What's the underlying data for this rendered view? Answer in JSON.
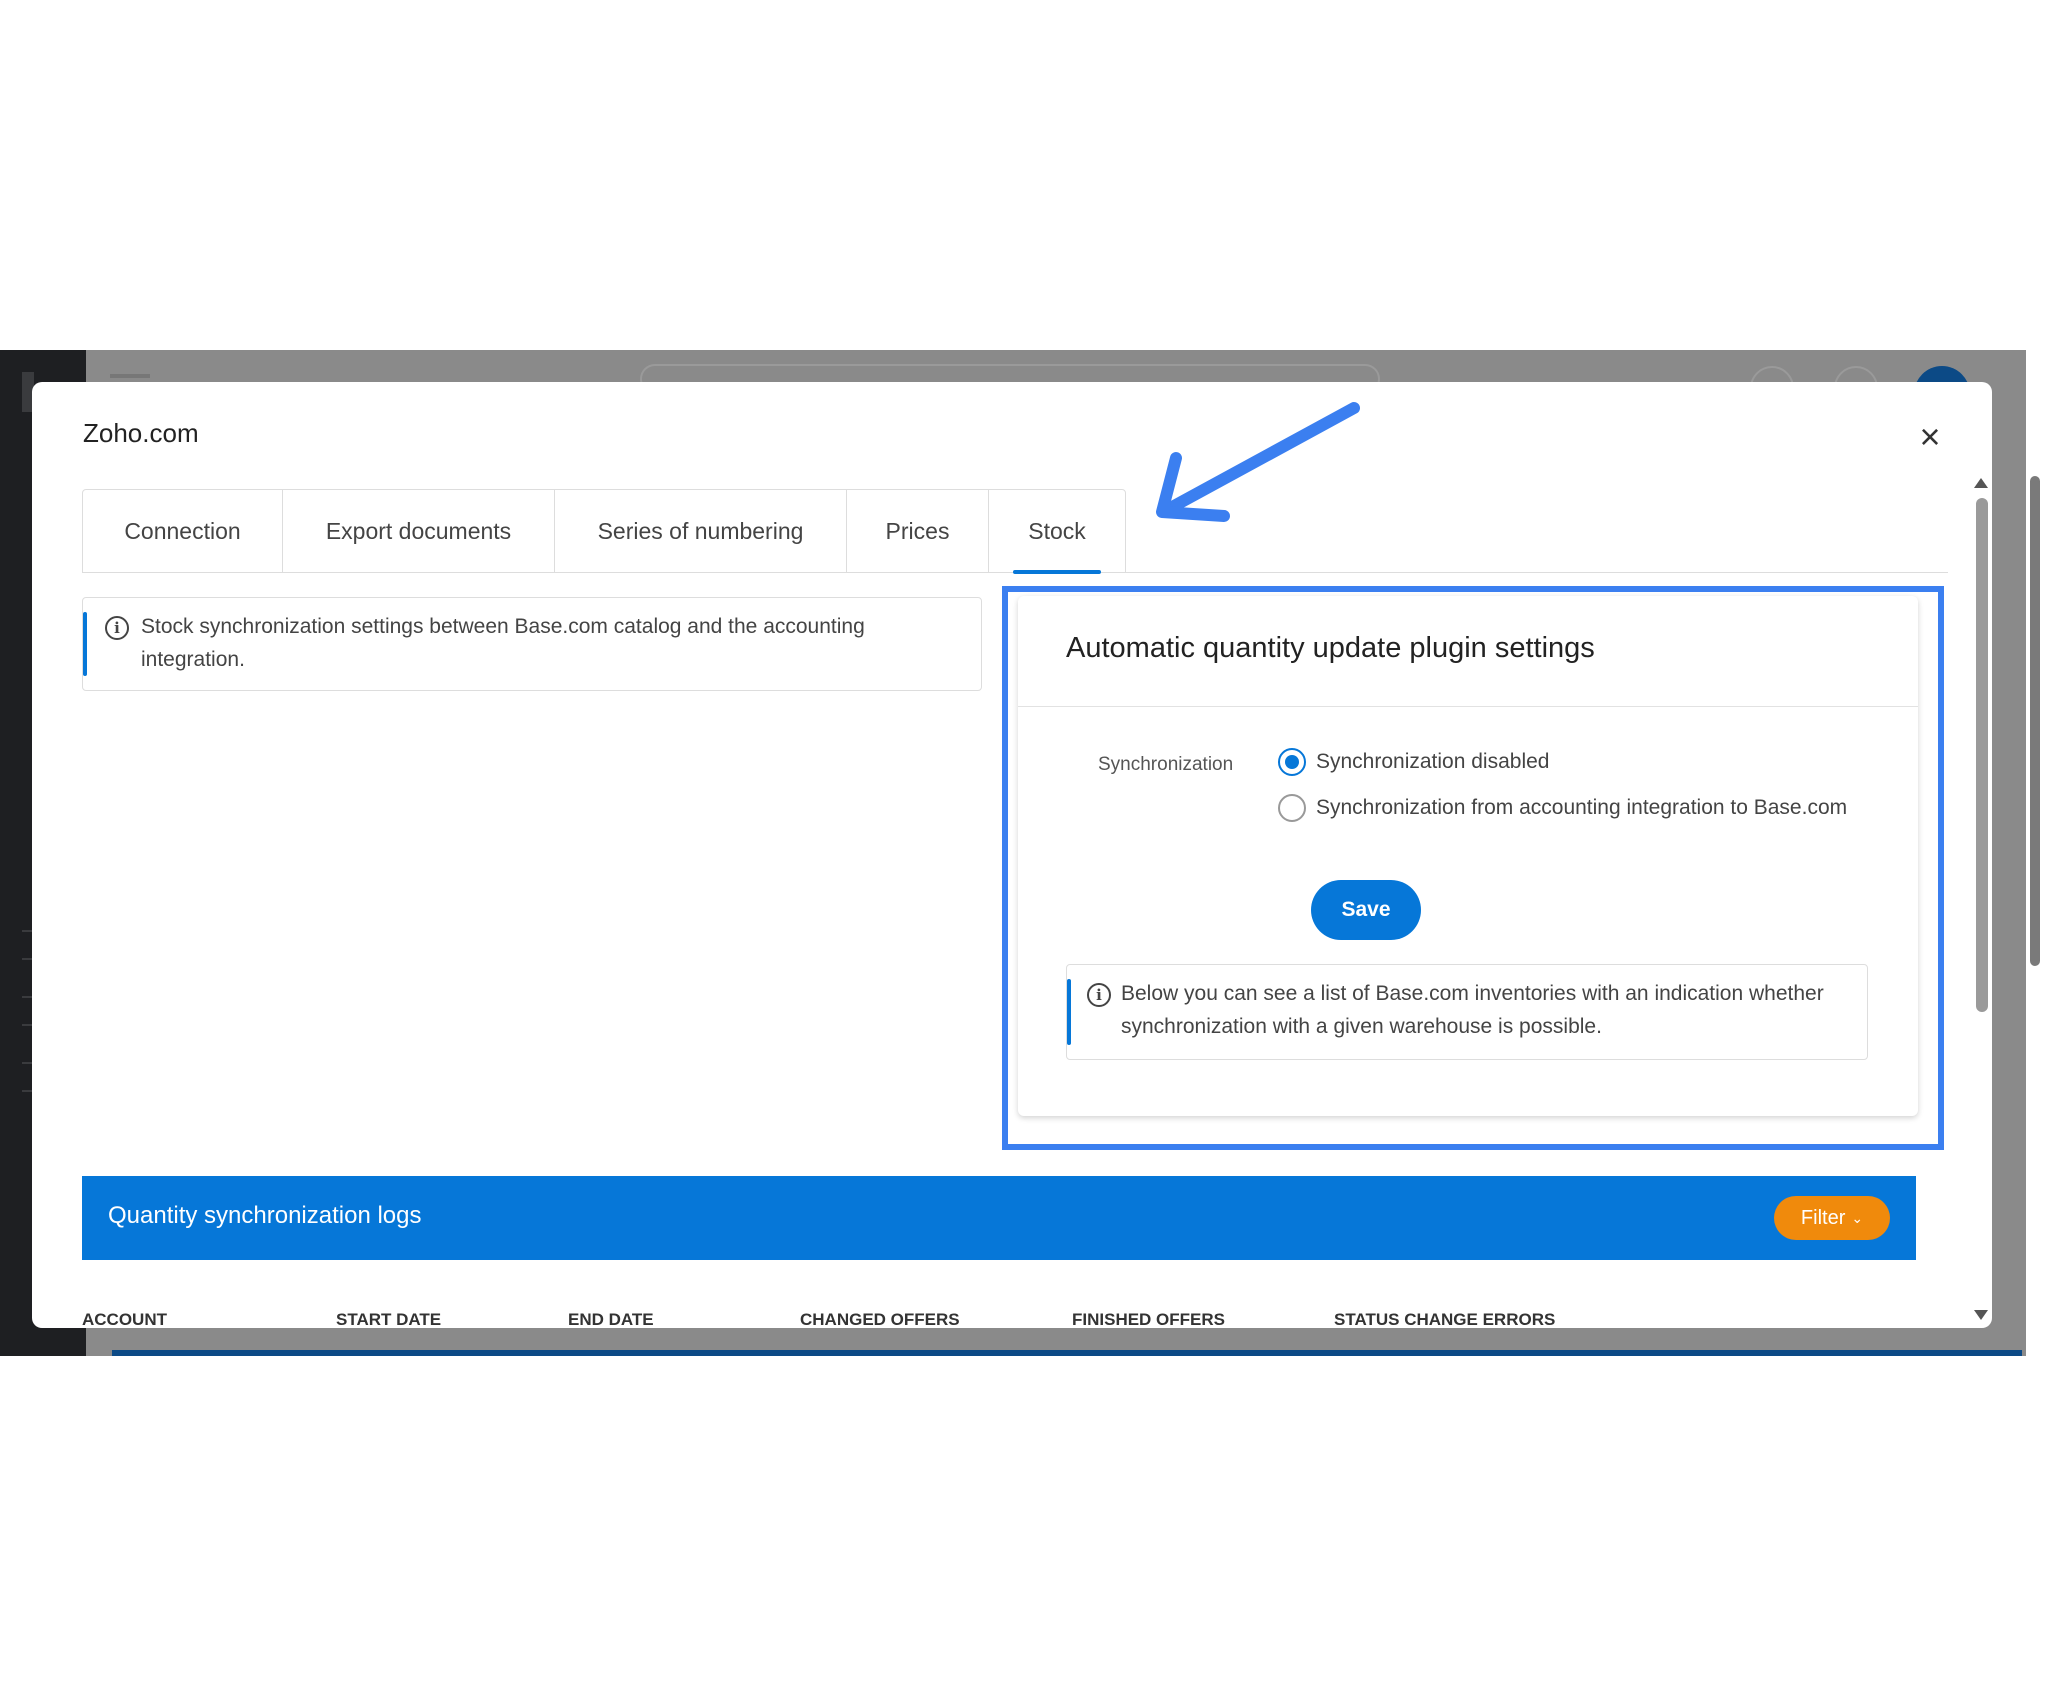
{
  "modal": {
    "title": "Zoho.com",
    "close_icon": "close-icon"
  },
  "tabs": [
    {
      "label": "Connection",
      "active": false
    },
    {
      "label": "Export documents",
      "active": false
    },
    {
      "label": "Series of numbering",
      "active": false
    },
    {
      "label": "Prices",
      "active": false
    },
    {
      "label": "Stock",
      "active": true
    }
  ],
  "stock_info": {
    "text": "Stock synchronization settings between Base.com catalog and the accounting integration.",
    "icon": "info-icon"
  },
  "plugin_settings": {
    "title": "Automatic quantity update plugin settings",
    "sync_label": "Synchronization",
    "options": [
      {
        "label": "Synchronization disabled",
        "checked": true
      },
      {
        "label": "Synchronization from accounting integration to Base.com",
        "checked": false
      }
    ],
    "save_label": "Save",
    "inventory_info": "Below you can see a list of Base.com inventories with an indication whether synchronization with a given warehouse is possible."
  },
  "logs": {
    "title": "Quantity synchronization logs",
    "filter_label": "Filter",
    "columns": [
      "ACCOUNT",
      "START DATE",
      "END DATE",
      "CHANGED OFFERS",
      "FINISHED OFFERS",
      "STATUS CHANGE ERRORS"
    ]
  },
  "colors": {
    "accent_blue": "#0677d8",
    "filter_orange": "#f08a0c",
    "annotation_blue": "#3b7ff0"
  }
}
